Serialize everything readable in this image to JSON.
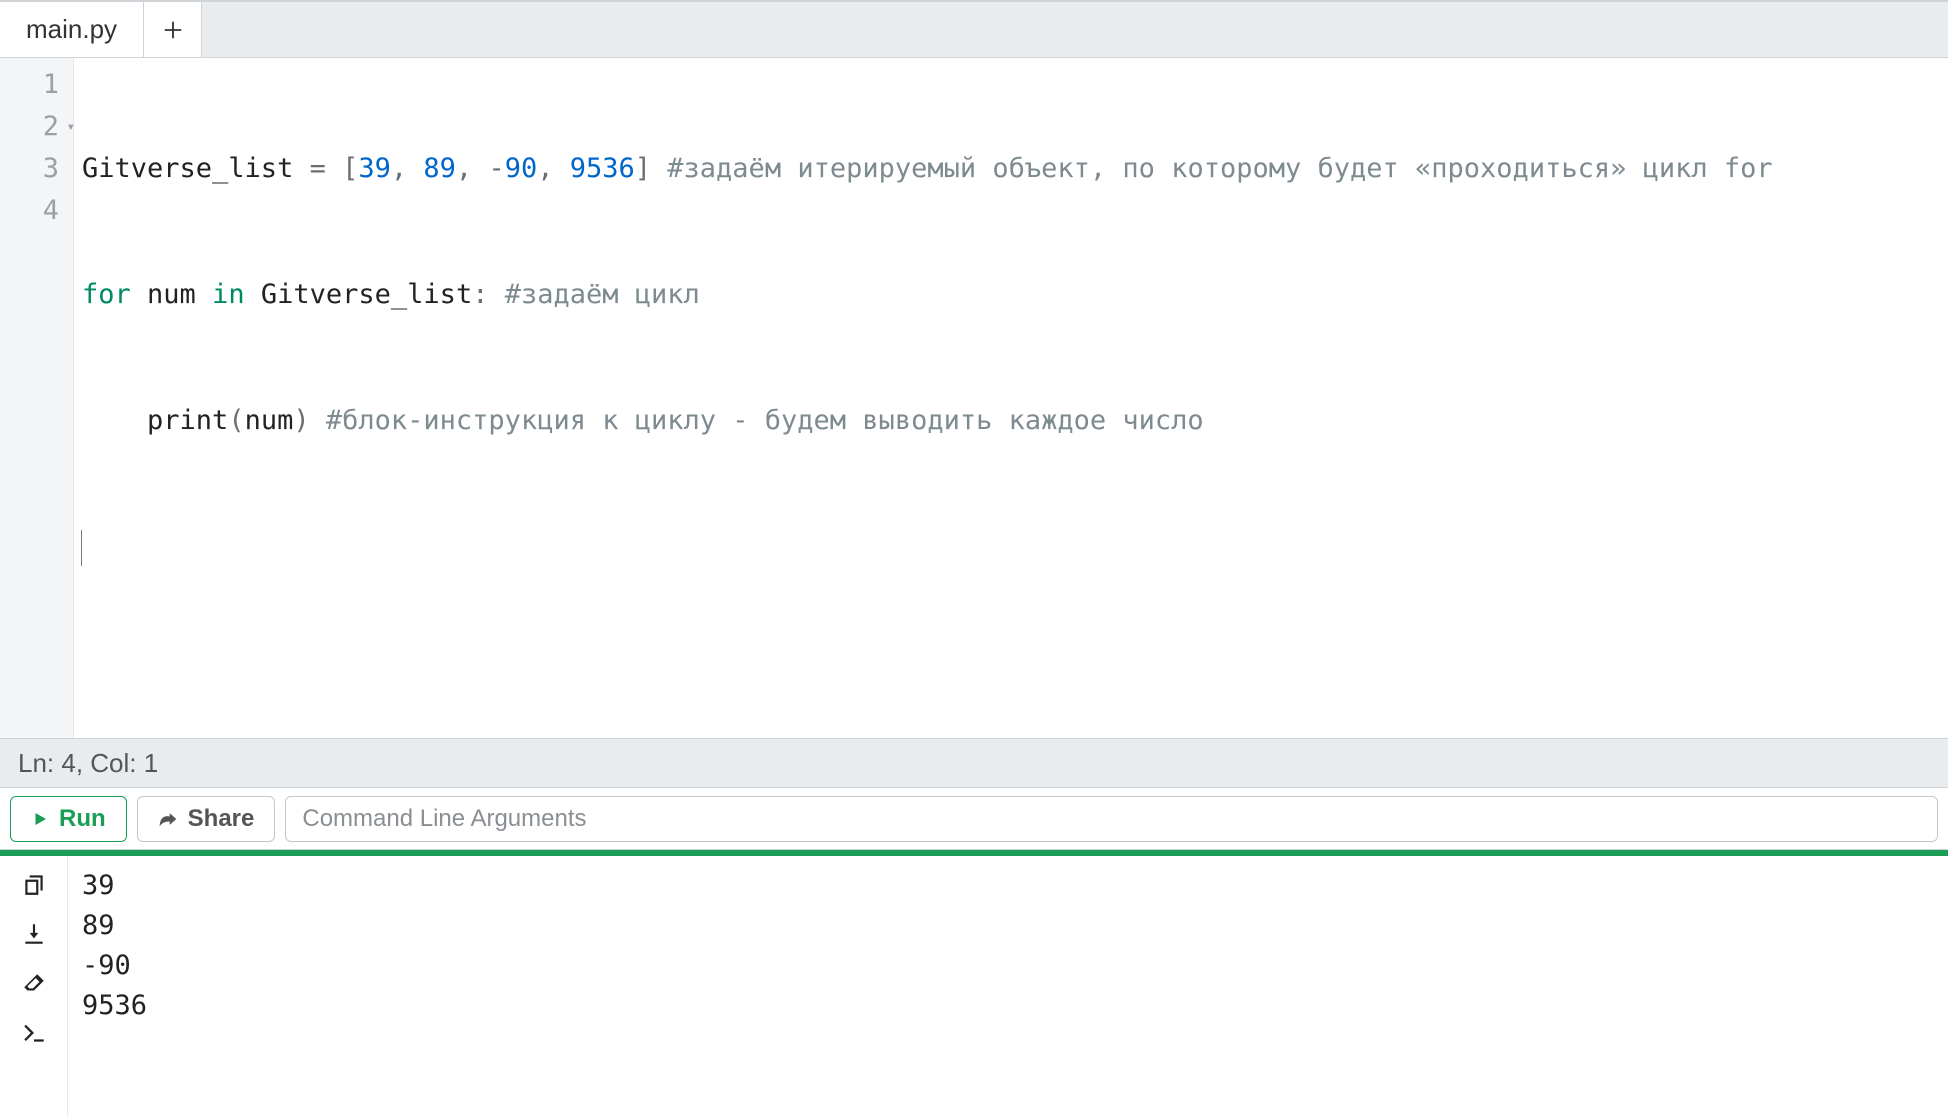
{
  "tabs": {
    "active": "main.py"
  },
  "editor": {
    "lines": [
      {
        "num": "1",
        "fold": false
      },
      {
        "num": "2",
        "fold": true
      },
      {
        "num": "3",
        "fold": false
      },
      {
        "num": "4",
        "fold": false
      }
    ],
    "code": {
      "l1_id": "Gitverse_list",
      "l1_eq": " = ",
      "l1_lb": "[",
      "l1_n1": "39",
      "l1_c1": ", ",
      "l1_n2": "89",
      "l1_c2": ", ",
      "l1_neg": "-",
      "l1_n3": "90",
      "l1_c3": ", ",
      "l1_n4": "9536",
      "l1_rb": "] ",
      "l1_cm": "#задаём итерируемый объект, по которому будет «проходиться» цикл for",
      "l2_for": "for",
      "l2_sp1": " ",
      "l2_num": "num",
      "l2_sp2": " ",
      "l2_in": "in",
      "l2_sp3": " ",
      "l2_list": "Gitverse_list",
      "l2_colon": ": ",
      "l2_cm": "#задаём цикл",
      "l3_indent": "    ",
      "l3_print": "print",
      "l3_lp": "(",
      "l3_arg": "num",
      "l3_rp": ") ",
      "l3_cm": "#блок-инструкция к циклу - будем выводить каждое число"
    }
  },
  "status": {
    "text": "Ln: 4,  Col: 1"
  },
  "toolbar": {
    "run_label": "Run",
    "share_label": "Share",
    "cmd_placeholder": "Command Line Arguments"
  },
  "output": {
    "lines": [
      "39",
      "89",
      "-90",
      "9536"
    ]
  }
}
